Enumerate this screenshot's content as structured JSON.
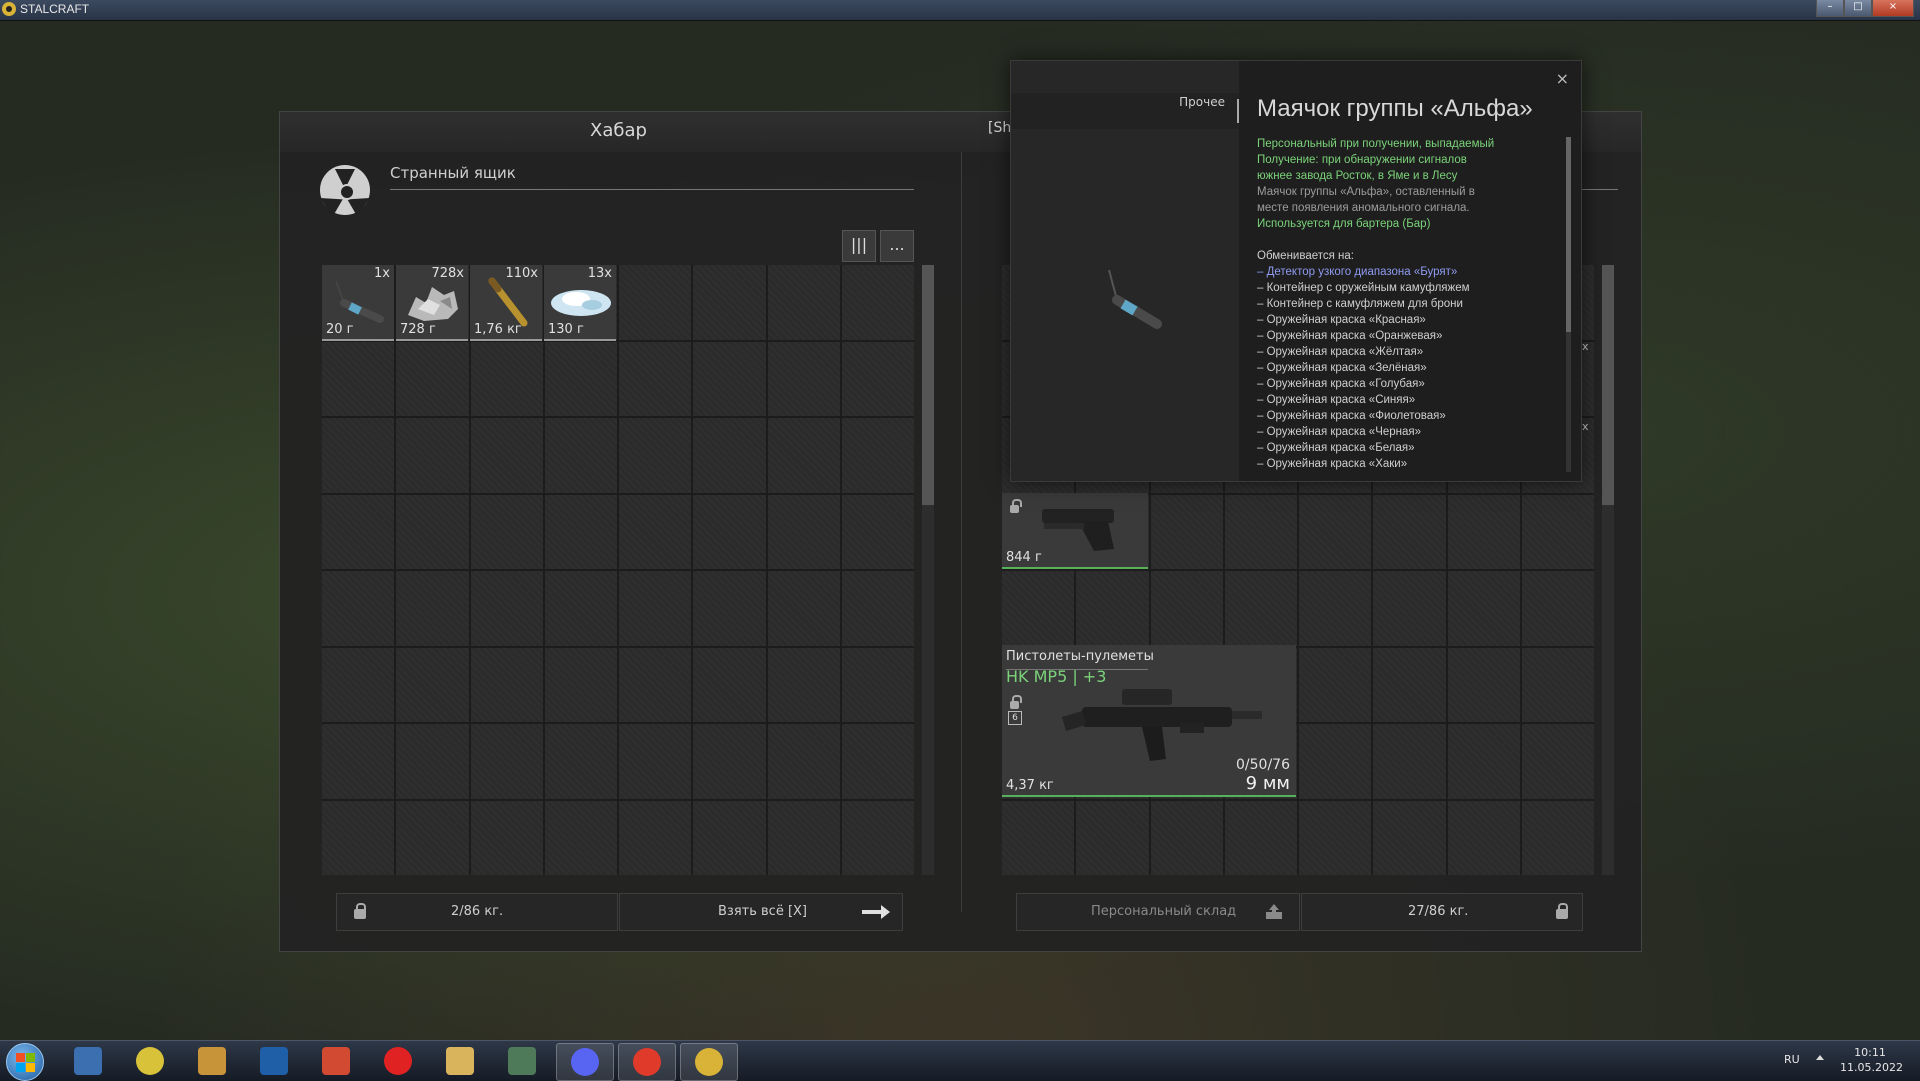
{
  "window": {
    "title": "STALCRAFT"
  },
  "left_panel": {
    "title": "Хабар",
    "container_name": "Странный ящик",
    "tools": {
      "sort_label": "|||",
      "more_label": "..."
    },
    "items": [
      {
        "qty": "1x",
        "weight": "20 г",
        "icon": "beacon-icon"
      },
      {
        "qty": "728x",
        "weight": "728 г",
        "icon": "scrap-icon"
      },
      {
        "qty": "110x",
        "weight": "1,76 кг",
        "icon": "ammo-icon"
      },
      {
        "qty": "13x",
        "weight": "130 г",
        "icon": "crystal-icon"
      }
    ],
    "weight_text": "2/86 кг.",
    "take_all_label": "Взять всё [X]"
  },
  "right_panel": {
    "title_partial": "[Sh",
    "pistol": {
      "weight": "844 г"
    },
    "smg": {
      "category": "Пистолеты-пулеметы",
      "name": "HK MP5 | +3",
      "tier": "6",
      "ammo": "0/50/76",
      "caliber": "9 мм",
      "weight": "4,37 кг"
    },
    "hidden_fragments": {
      "a": "x",
      "b": "x"
    },
    "storage_label": "Персональный склад",
    "weight_text": "27/86 кг."
  },
  "tooltip": {
    "category": "Прочее",
    "title": "Маячок группы «Альфа»",
    "close_label": "×",
    "lines": [
      {
        "text": "Персональный при получении, выпадаемый",
        "cls": "g"
      },
      {
        "text": "Получение: при обнаружении сигналов",
        "cls": "g"
      },
      {
        "text": "южнее завода Росток, в Яме и в Лесу",
        "cls": "g"
      },
      {
        "text": "Маячок группы «Альфа», оставленный в",
        "cls": "gr"
      },
      {
        "text": "месте появления аномального сигнала.",
        "cls": "gr"
      },
      {
        "text": "Используется для бартера (Бар)",
        "cls": "g"
      },
      {
        "text": "",
        "cls": "gr"
      },
      {
        "text": "Обменивается на:",
        "cls": "w2"
      },
      {
        "text": "– Детектор узкого диапазона «Бурят»",
        "cls": "lk"
      },
      {
        "text": "– Контейнер с оружейным камуфляжем",
        "cls": "w2"
      },
      {
        "text": "– Контейнер с камуфляжем для брони",
        "cls": "w2"
      },
      {
        "text": "– Оружейная краска «Красная»",
        "cls": "w2"
      },
      {
        "text": "– Оружейная краска «Оранжевая»",
        "cls": "w2"
      },
      {
        "text": "– Оружейная краска «Жёлтая»",
        "cls": "w2"
      },
      {
        "text": "– Оружейная краска «Зелёная»",
        "cls": "w2"
      },
      {
        "text": "– Оружейная краска «Голубая»",
        "cls": "w2"
      },
      {
        "text": "– Оружейная краска «Синяя»",
        "cls": "w2"
      },
      {
        "text": "– Оружейная краска «Фиолетовая»",
        "cls": "w2"
      },
      {
        "text": "– Оружейная краска «Черная»",
        "cls": "w2"
      },
      {
        "text": "– Оружейная краска «Белая»",
        "cls": "w2"
      },
      {
        "text": "– Оружейная краска «Хаки»",
        "cls": "w2"
      }
    ]
  },
  "taskbar": {
    "apps": [
      "explorer-icon",
      "chrome-icon",
      "stalker-icon",
      "photoshop-icon",
      "ccleaner-icon",
      "opera-icon",
      "folder-icon",
      "monitor-icon",
      "discord-icon",
      "yandex-icon",
      "stalcraft-icon"
    ],
    "lang": "RU",
    "time": "10:11",
    "date": "11.05.2022"
  },
  "colors": {
    "accent_green": "#7bd37a",
    "link": "#8e9bf0",
    "panel": "#222222"
  }
}
